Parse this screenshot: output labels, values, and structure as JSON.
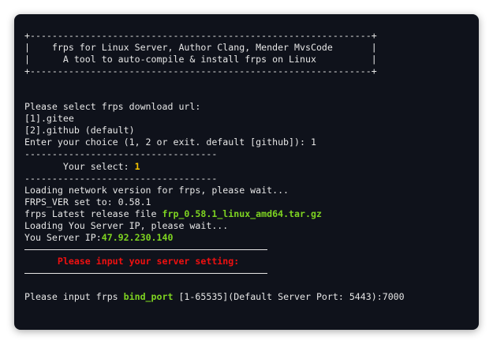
{
  "terminal": {
    "banner": {
      "border": "+--------------------------------------------------------------+",
      "line1": "|    frps for Linux Server, Author Clang, Mender MvsCode       |",
      "line2": "|      A tool to auto-compile & install frps on Linux          |"
    },
    "select_prompt": "Please select frps download url:",
    "option1": "[1].gitee",
    "option2": "[2].github (default)",
    "choice_prompt": "Enter your choice (1, 2 or exit. default [github]): 1",
    "dashes": "-----------------------------------",
    "your_select_label": "       Your select: ",
    "your_select_value": "1",
    "loading_version": "Loading network version for frps, please wait...",
    "frps_ver": "FRPS_VER set to: 0.58.1",
    "release_label": "frps Latest release file ",
    "release_file": "frp_0.58.1_linux_amd64.tar.gz",
    "loading_ip": "Loading You Server IP, please wait...",
    "server_ip_label": "You Server IP:",
    "server_ip": "47.92.230.140",
    "setting_heading": "      Please input your server setting:",
    "port_prompt_prefix": "Please input frps ",
    "port_key": "bind_port",
    "port_prompt_suffix": " [1-65535](Default Server Port: 5443):",
    "port_input": "7000"
  }
}
